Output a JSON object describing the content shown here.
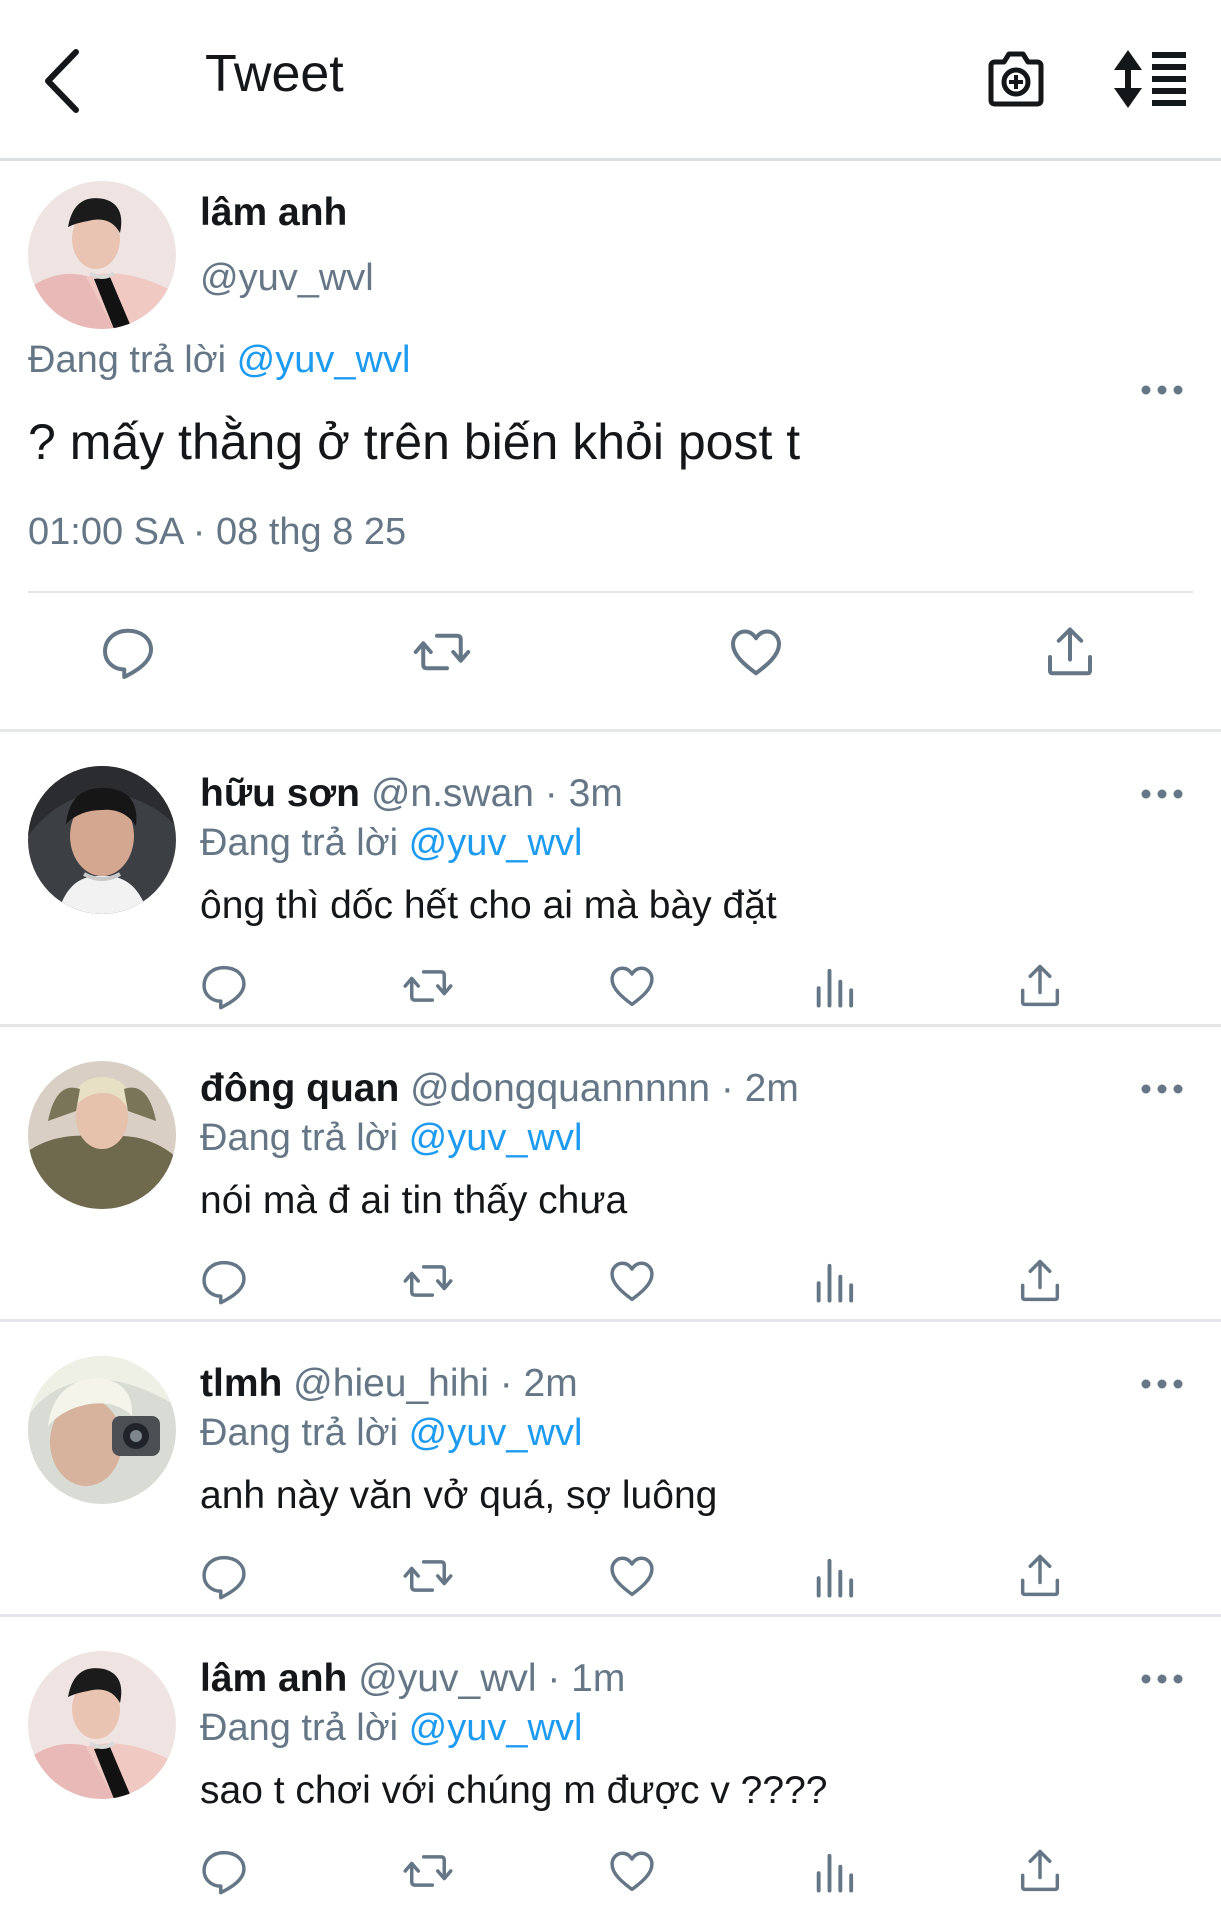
{
  "header": {
    "title": "Tweet"
  },
  "main_tweet": {
    "name": "lâm anh",
    "handle": "@yuv_wvl",
    "reply_label": "Đang trả lời",
    "reply_to": "@yuv_wvl",
    "text": "? mấy thằng ở trên biến khỏi post t",
    "timestamp": "01:00 SA · 08 thg 8 25"
  },
  "replies": [
    {
      "name": "hữu sơn",
      "meta": "@n.swan · 3m",
      "reply_label": "Đang trả lời",
      "reply_to": "@yuv_wvl",
      "text": "ông thì dốc hết cho ai mà bày đặt"
    },
    {
      "name": "đông quan",
      "meta": "@dongquannnnn · 2m",
      "reply_label": "Đang trả lời",
      "reply_to": "@yuv_wvl",
      "text": "nói mà đ ai tin thấy chưa"
    },
    {
      "name": "tlmh",
      "meta": "@hieu_hihi · 2m",
      "reply_label": "Đang trả lời",
      "reply_to": "@yuv_wvl",
      "text": "anh này văn vở quá, sợ luông"
    },
    {
      "name": "lâm anh",
      "meta": "@yuv_wvl · 1m",
      "reply_label": "Đang trả lời",
      "reply_to": "@yuv_wvl",
      "text": "sao t chơi với chúng m được v ????"
    }
  ],
  "icons": {
    "back": "chevron-left-icon",
    "camera": "camera-plus-icon",
    "sort": "sort-list-icon",
    "reply": "speech-bubble-icon",
    "retweet": "retweet-icon",
    "like": "heart-icon",
    "analytics": "bar-chart-icon",
    "share": "share-icon",
    "more": "more-dots-icon"
  },
  "colors": {
    "text": "#14171a",
    "secondary": "#657786",
    "accent": "#1d9bf0",
    "divider": "#e4e6e9"
  }
}
